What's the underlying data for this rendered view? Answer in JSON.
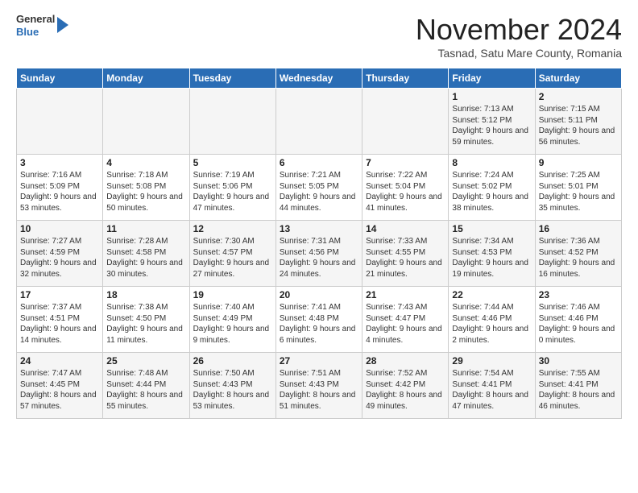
{
  "logo": {
    "general": "General",
    "blue": "Blue"
  },
  "header": {
    "month": "November 2024",
    "location": "Tasnad, Satu Mare County, Romania"
  },
  "weekdays": [
    "Sunday",
    "Monday",
    "Tuesday",
    "Wednesday",
    "Thursday",
    "Friday",
    "Saturday"
  ],
  "weeks": [
    [
      {
        "day": "",
        "content": ""
      },
      {
        "day": "",
        "content": ""
      },
      {
        "day": "",
        "content": ""
      },
      {
        "day": "",
        "content": ""
      },
      {
        "day": "",
        "content": ""
      },
      {
        "day": "1",
        "content": "Sunrise: 7:13 AM\nSunset: 5:12 PM\nDaylight: 9 hours and 59 minutes."
      },
      {
        "day": "2",
        "content": "Sunrise: 7:15 AM\nSunset: 5:11 PM\nDaylight: 9 hours and 56 minutes."
      }
    ],
    [
      {
        "day": "3",
        "content": "Sunrise: 7:16 AM\nSunset: 5:09 PM\nDaylight: 9 hours and 53 minutes."
      },
      {
        "day": "4",
        "content": "Sunrise: 7:18 AM\nSunset: 5:08 PM\nDaylight: 9 hours and 50 minutes."
      },
      {
        "day": "5",
        "content": "Sunrise: 7:19 AM\nSunset: 5:06 PM\nDaylight: 9 hours and 47 minutes."
      },
      {
        "day": "6",
        "content": "Sunrise: 7:21 AM\nSunset: 5:05 PM\nDaylight: 9 hours and 44 minutes."
      },
      {
        "day": "7",
        "content": "Sunrise: 7:22 AM\nSunset: 5:04 PM\nDaylight: 9 hours and 41 minutes."
      },
      {
        "day": "8",
        "content": "Sunrise: 7:24 AM\nSunset: 5:02 PM\nDaylight: 9 hours and 38 minutes."
      },
      {
        "day": "9",
        "content": "Sunrise: 7:25 AM\nSunset: 5:01 PM\nDaylight: 9 hours and 35 minutes."
      }
    ],
    [
      {
        "day": "10",
        "content": "Sunrise: 7:27 AM\nSunset: 4:59 PM\nDaylight: 9 hours and 32 minutes."
      },
      {
        "day": "11",
        "content": "Sunrise: 7:28 AM\nSunset: 4:58 PM\nDaylight: 9 hours and 30 minutes."
      },
      {
        "day": "12",
        "content": "Sunrise: 7:30 AM\nSunset: 4:57 PM\nDaylight: 9 hours and 27 minutes."
      },
      {
        "day": "13",
        "content": "Sunrise: 7:31 AM\nSunset: 4:56 PM\nDaylight: 9 hours and 24 minutes."
      },
      {
        "day": "14",
        "content": "Sunrise: 7:33 AM\nSunset: 4:55 PM\nDaylight: 9 hours and 21 minutes."
      },
      {
        "day": "15",
        "content": "Sunrise: 7:34 AM\nSunset: 4:53 PM\nDaylight: 9 hours and 19 minutes."
      },
      {
        "day": "16",
        "content": "Sunrise: 7:36 AM\nSunset: 4:52 PM\nDaylight: 9 hours and 16 minutes."
      }
    ],
    [
      {
        "day": "17",
        "content": "Sunrise: 7:37 AM\nSunset: 4:51 PM\nDaylight: 9 hours and 14 minutes."
      },
      {
        "day": "18",
        "content": "Sunrise: 7:38 AM\nSunset: 4:50 PM\nDaylight: 9 hours and 11 minutes."
      },
      {
        "day": "19",
        "content": "Sunrise: 7:40 AM\nSunset: 4:49 PM\nDaylight: 9 hours and 9 minutes."
      },
      {
        "day": "20",
        "content": "Sunrise: 7:41 AM\nSunset: 4:48 PM\nDaylight: 9 hours and 6 minutes."
      },
      {
        "day": "21",
        "content": "Sunrise: 7:43 AM\nSunset: 4:47 PM\nDaylight: 9 hours and 4 minutes."
      },
      {
        "day": "22",
        "content": "Sunrise: 7:44 AM\nSunset: 4:46 PM\nDaylight: 9 hours and 2 minutes."
      },
      {
        "day": "23",
        "content": "Sunrise: 7:46 AM\nSunset: 4:46 PM\nDaylight: 9 hours and 0 minutes."
      }
    ],
    [
      {
        "day": "24",
        "content": "Sunrise: 7:47 AM\nSunset: 4:45 PM\nDaylight: 8 hours and 57 minutes."
      },
      {
        "day": "25",
        "content": "Sunrise: 7:48 AM\nSunset: 4:44 PM\nDaylight: 8 hours and 55 minutes."
      },
      {
        "day": "26",
        "content": "Sunrise: 7:50 AM\nSunset: 4:43 PM\nDaylight: 8 hours and 53 minutes."
      },
      {
        "day": "27",
        "content": "Sunrise: 7:51 AM\nSunset: 4:43 PM\nDaylight: 8 hours and 51 minutes."
      },
      {
        "day": "28",
        "content": "Sunrise: 7:52 AM\nSunset: 4:42 PM\nDaylight: 8 hours and 49 minutes."
      },
      {
        "day": "29",
        "content": "Sunrise: 7:54 AM\nSunset: 4:41 PM\nDaylight: 8 hours and 47 minutes."
      },
      {
        "day": "30",
        "content": "Sunrise: 7:55 AM\nSunset: 4:41 PM\nDaylight: 8 hours and 46 minutes."
      }
    ]
  ]
}
